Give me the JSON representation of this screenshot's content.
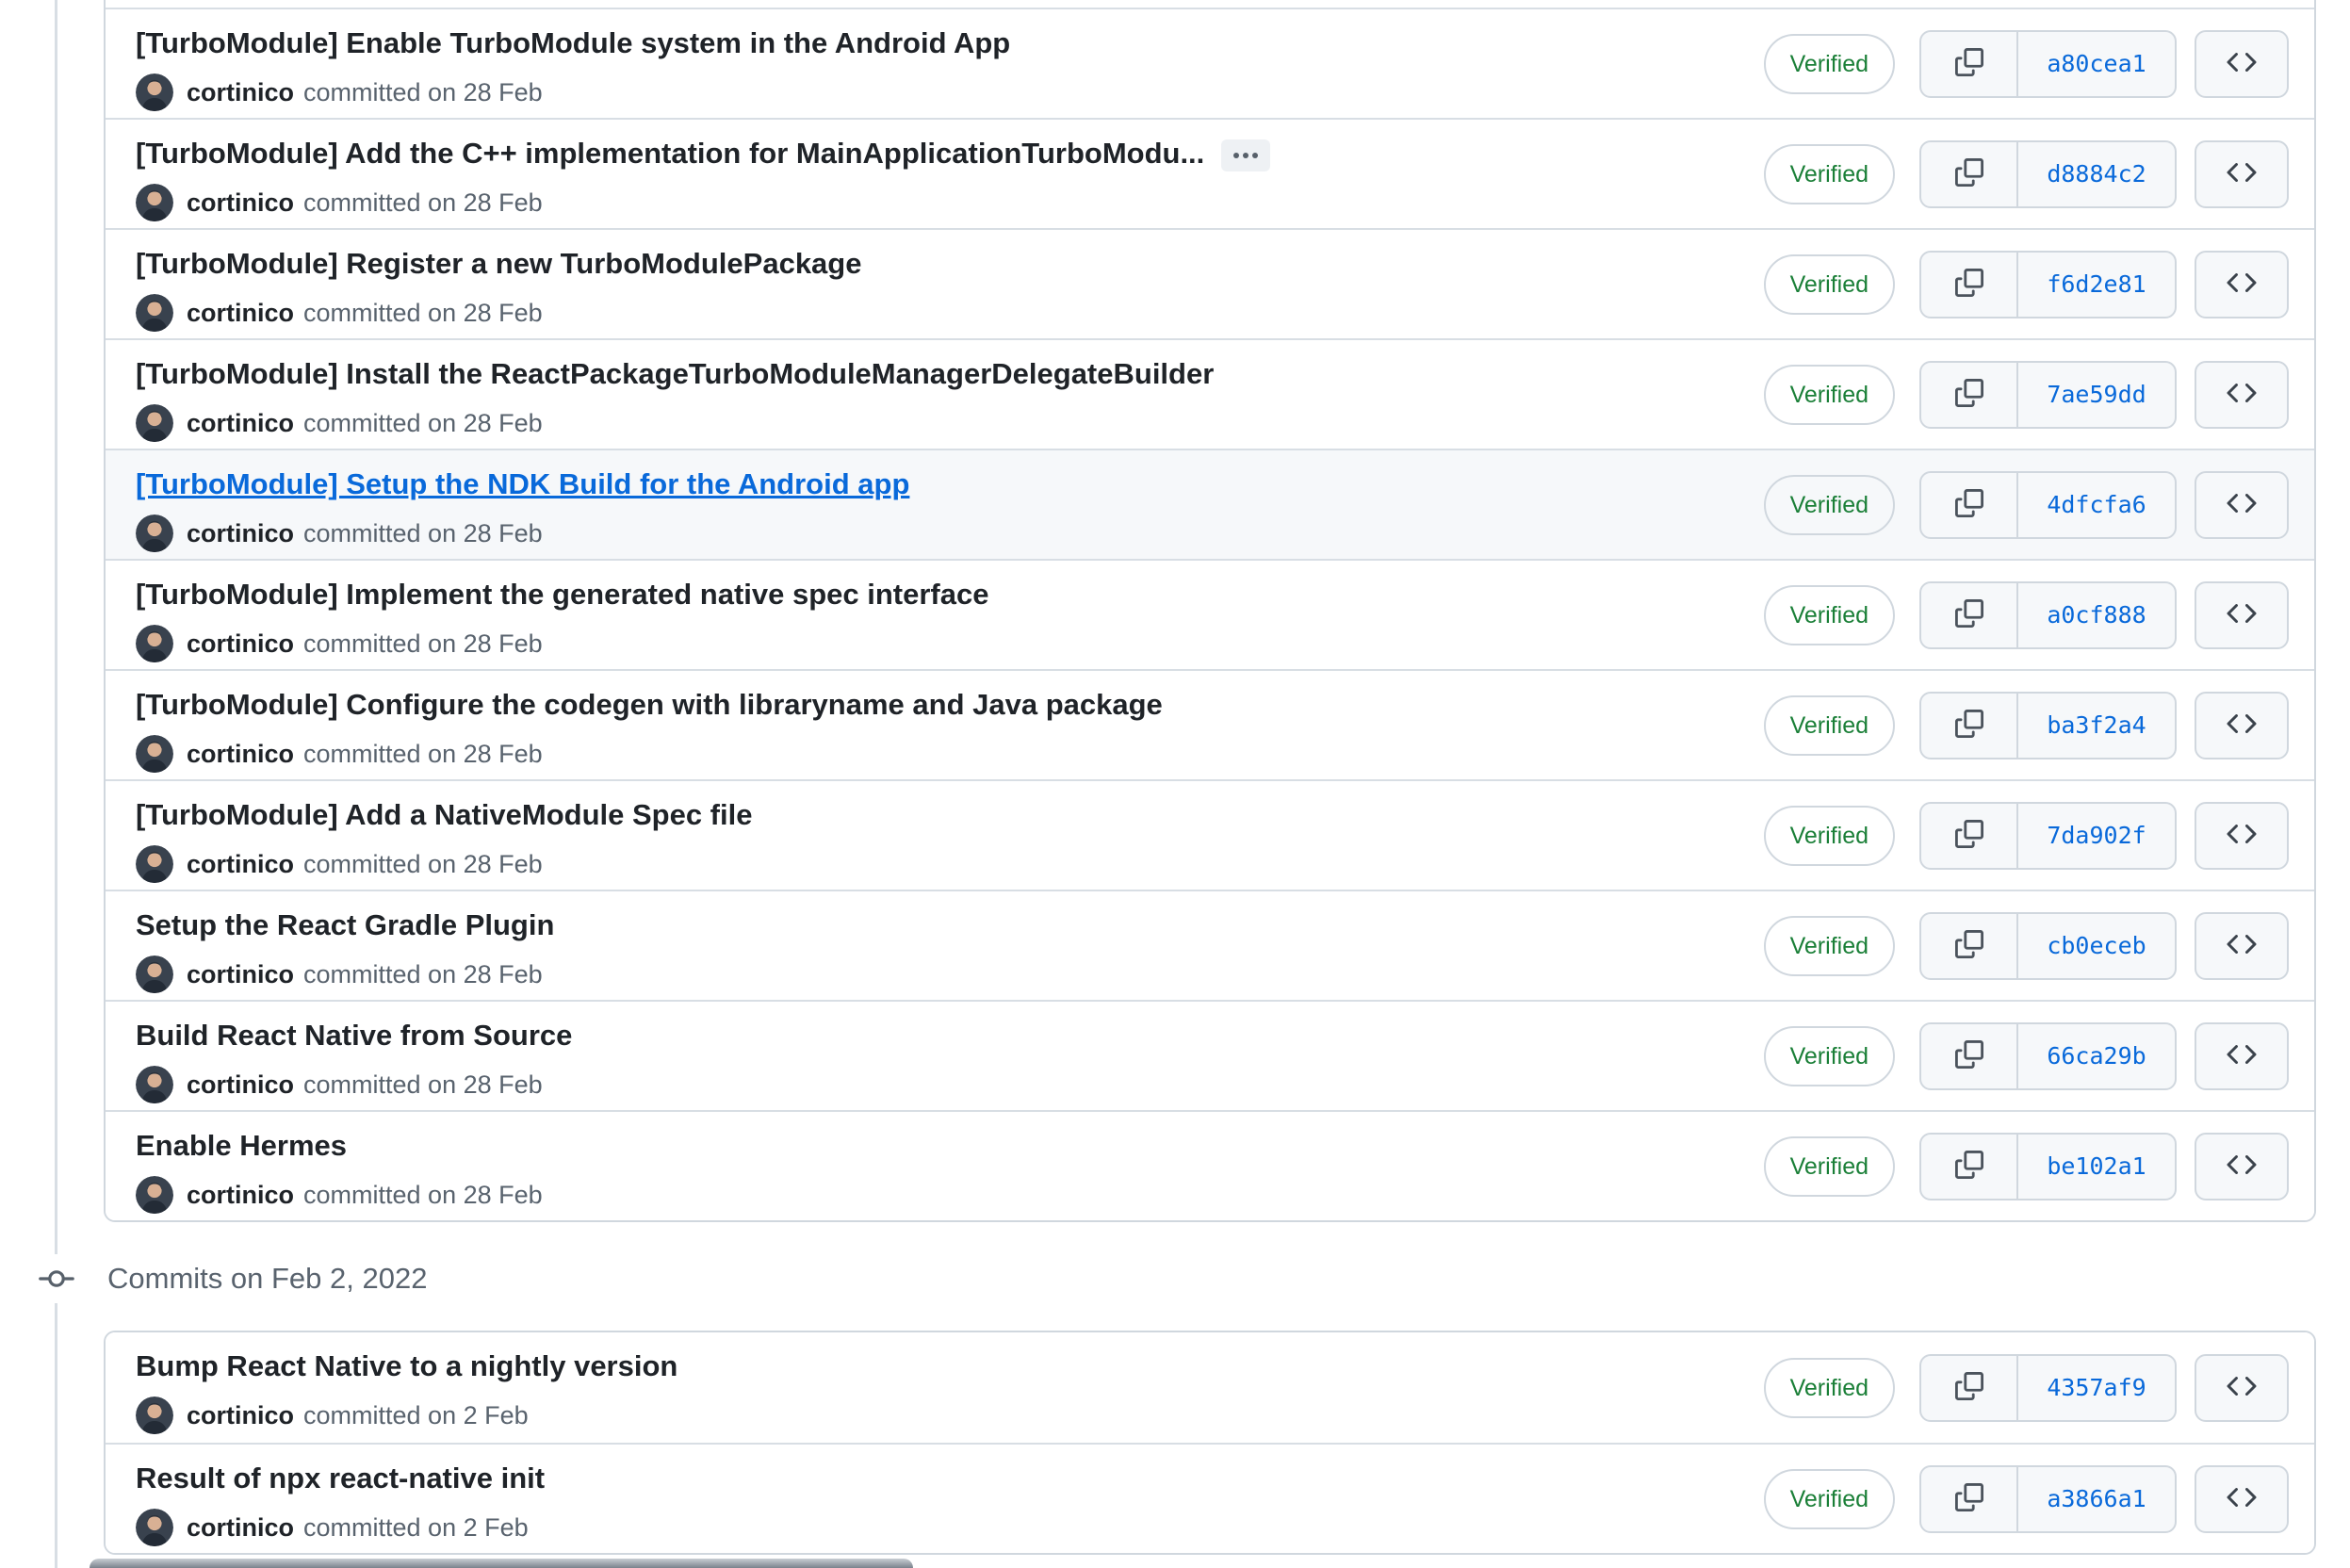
{
  "colors": {
    "link_blue": "#0969da",
    "verified_green": "#1a7f37",
    "container_border": "#d0d7de",
    "row_divider": "#d8dee4",
    "button_bg": "#f6f8fa",
    "text_primary": "#1f2328",
    "text_muted": "#59636e",
    "row_highlight_bg": "#f6f8fa"
  },
  "icons": {
    "copy": "copy-icon",
    "browse_code": "code-icon",
    "timeline_node": "git-commit-icon",
    "ellipsis": "ellipsis-icon"
  },
  "groups": [
    {
      "commits": [
        {
          "title": "[TurboModule] Enable TurboModule system in the Android App",
          "author": "cortinico",
          "action": "committed on 28 Feb",
          "badge": "Verified",
          "sha": "a80cea1",
          "highlighted": false,
          "ellipsis": false
        },
        {
          "title": "[TurboModule] Add the C++ implementation for MainApplicationTurboModu...",
          "author": "cortinico",
          "action": "committed on 28 Feb",
          "badge": "Verified",
          "sha": "d8884c2",
          "highlighted": false,
          "ellipsis": true
        },
        {
          "title": "[TurboModule] Register a new TurboModulePackage",
          "author": "cortinico",
          "action": "committed on 28 Feb",
          "badge": "Verified",
          "sha": "f6d2e81",
          "highlighted": false,
          "ellipsis": false
        },
        {
          "title": "[TurboModule] Install the ReactPackageTurboModuleManagerDelegateBuilder",
          "author": "cortinico",
          "action": "committed on 28 Feb",
          "badge": "Verified",
          "sha": "7ae59dd",
          "highlighted": false,
          "ellipsis": false
        },
        {
          "title": "[TurboModule] Setup the NDK Build for the Android app",
          "author": "cortinico",
          "action": "committed on 28 Feb",
          "badge": "Verified",
          "sha": "4dfcfa6",
          "highlighted": true,
          "ellipsis": false
        },
        {
          "title": "[TurboModule] Implement the generated native spec interface",
          "author": "cortinico",
          "action": "committed on 28 Feb",
          "badge": "Verified",
          "sha": "a0cf888",
          "highlighted": false,
          "ellipsis": false
        },
        {
          "title": "[TurboModule] Configure the codegen with libraryname and Java package",
          "author": "cortinico",
          "action": "committed on 28 Feb",
          "badge": "Verified",
          "sha": "ba3f2a4",
          "highlighted": false,
          "ellipsis": false
        },
        {
          "title": "[TurboModule] Add a NativeModule Spec file",
          "author": "cortinico",
          "action": "committed on 28 Feb",
          "badge": "Verified",
          "sha": "7da902f",
          "highlighted": false,
          "ellipsis": false
        },
        {
          "title": "Setup the React Gradle Plugin",
          "author": "cortinico",
          "action": "committed on 28 Feb",
          "badge": "Verified",
          "sha": "cb0eceb",
          "highlighted": false,
          "ellipsis": false
        },
        {
          "title": "Build React Native from Source",
          "author": "cortinico",
          "action": "committed on 28 Feb",
          "badge": "Verified",
          "sha": "66ca29b",
          "highlighted": false,
          "ellipsis": false
        },
        {
          "title": "Enable Hermes",
          "author": "cortinico",
          "action": "committed on 28 Feb",
          "badge": "Verified",
          "sha": "be102a1",
          "highlighted": false,
          "ellipsis": false
        }
      ]
    },
    {
      "header": "Commits on Feb 2, 2022",
      "commits": [
        {
          "title": "Bump React Native to a nightly version",
          "author": "cortinico",
          "action": "committed on 2 Feb",
          "badge": "Verified",
          "sha": "4357af9",
          "highlighted": false,
          "ellipsis": false
        },
        {
          "title": "Result of npx react-native init",
          "author": "cortinico",
          "action": "committed on 2 Feb",
          "badge": "Verified",
          "sha": "a3866a1",
          "highlighted": false,
          "ellipsis": false
        }
      ]
    }
  ]
}
